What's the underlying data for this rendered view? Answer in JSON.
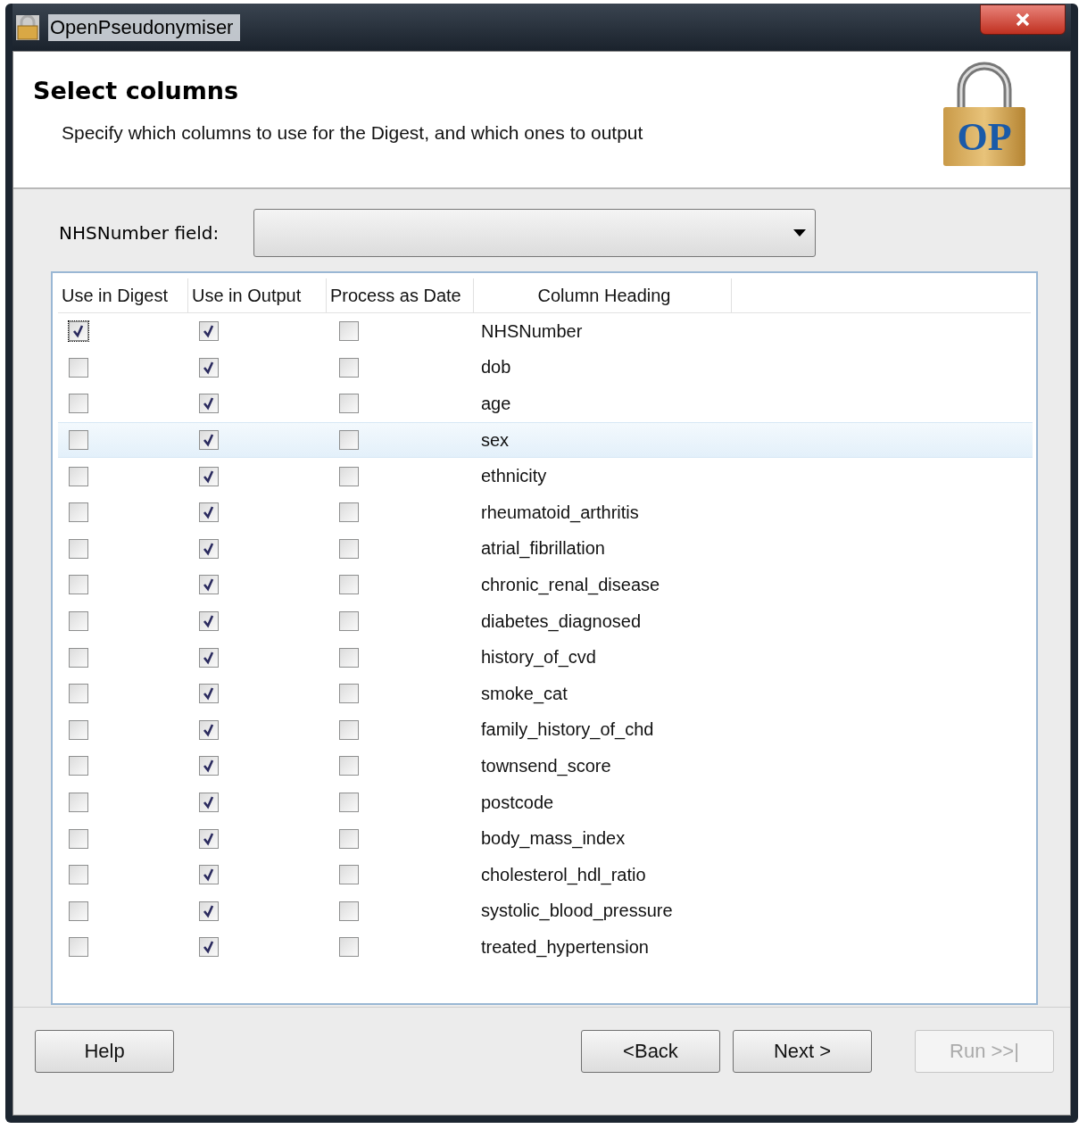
{
  "window": {
    "title": "OpenPseudonymiser"
  },
  "header": {
    "title": "Select columns",
    "subtitle": "Specify which columns to use for the Digest, and which ones to output",
    "logo_text": "OP"
  },
  "nhs_field": {
    "label": "NHSNumber field:"
  },
  "table": {
    "columns": [
      "Use in Digest",
      "Use in Output",
      "Process as Date",
      "Column Heading"
    ],
    "rows": [
      {
        "digest": true,
        "output": true,
        "date": false,
        "heading": "NHSNumber",
        "selected": false
      },
      {
        "digest": false,
        "output": true,
        "date": false,
        "heading": "dob",
        "selected": false
      },
      {
        "digest": false,
        "output": true,
        "date": false,
        "heading": "age",
        "selected": false
      },
      {
        "digest": false,
        "output": true,
        "date": false,
        "heading": "sex",
        "selected": true
      },
      {
        "digest": false,
        "output": true,
        "date": false,
        "heading": "ethnicity",
        "selected": false
      },
      {
        "digest": false,
        "output": true,
        "date": false,
        "heading": "rheumatoid_arthritis",
        "selected": false
      },
      {
        "digest": false,
        "output": true,
        "date": false,
        "heading": "atrial_fibrillation",
        "selected": false
      },
      {
        "digest": false,
        "output": true,
        "date": false,
        "heading": "chronic_renal_disease",
        "selected": false
      },
      {
        "digest": false,
        "output": true,
        "date": false,
        "heading": "diabetes_diagnosed",
        "selected": false
      },
      {
        "digest": false,
        "output": true,
        "date": false,
        "heading": "history_of_cvd",
        "selected": false
      },
      {
        "digest": false,
        "output": true,
        "date": false,
        "heading": "smoke_cat",
        "selected": false
      },
      {
        "digest": false,
        "output": true,
        "date": false,
        "heading": "family_history_of_chd",
        "selected": false
      },
      {
        "digest": false,
        "output": true,
        "date": false,
        "heading": "townsend_score",
        "selected": false
      },
      {
        "digest": false,
        "output": true,
        "date": false,
        "heading": "postcode",
        "selected": false
      },
      {
        "digest": false,
        "output": true,
        "date": false,
        "heading": "body_mass_index",
        "selected": false
      },
      {
        "digest": false,
        "output": true,
        "date": false,
        "heading": "cholesterol_hdl_ratio",
        "selected": false
      },
      {
        "digest": false,
        "output": true,
        "date": false,
        "heading": "systolic_blood_pressure",
        "selected": false
      },
      {
        "digest": false,
        "output": true,
        "date": false,
        "heading": "treated_hypertension",
        "selected": false
      }
    ]
  },
  "buttons": [
    {
      "label": "Help",
      "disabled": false
    },
    {
      "label": "<Back",
      "disabled": false
    },
    {
      "label": "Next >",
      "disabled": false
    },
    {
      "label": "Run >>|",
      "disabled": true
    }
  ]
}
